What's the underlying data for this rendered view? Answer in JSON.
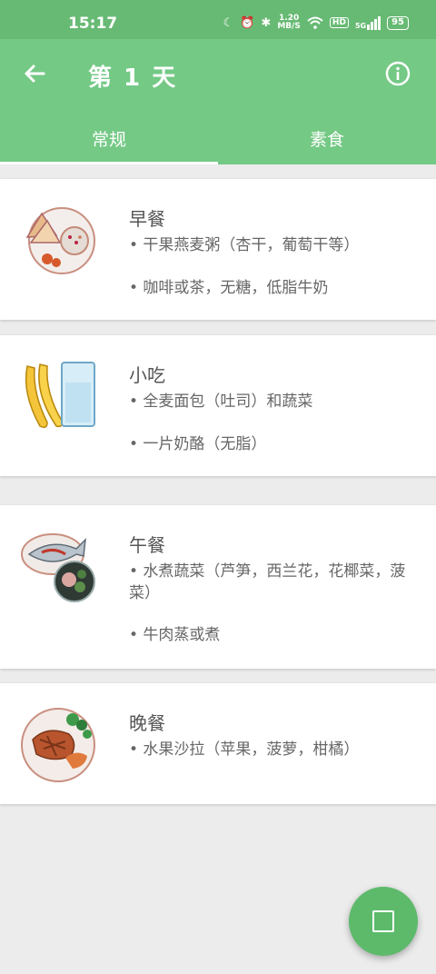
{
  "status": {
    "time": "15:17",
    "speed_value": "1.20",
    "speed_unit": "MB/S",
    "hd": "HD",
    "signal": "5G",
    "battery": "95"
  },
  "appbar": {
    "title": "第 1 天"
  },
  "tabs": [
    {
      "label": "常规",
      "active": true
    },
    {
      "label": "素食",
      "active": false
    }
  ],
  "meals": [
    {
      "title": "早餐",
      "items": [
        "• 干果燕麦粥（杏干，葡萄干等）",
        "• 咖啡或茶，无糖，低脂牛奶"
      ]
    },
    {
      "title": "小吃",
      "items": [
        "• 全麦面包（吐司）和蔬菜",
        "• 一片奶酪（无脂）"
      ]
    },
    {
      "title": "午餐",
      "items": [
        "• 水煮蔬菜（芦笋，西兰花，花椰菜，菠菜）",
        "• 牛肉蒸或煮"
      ]
    },
    {
      "title": "晚餐",
      "items": [
        "• 水果沙拉（苹果，菠萝，柑橘）"
      ]
    }
  ],
  "colors": {
    "statusbar": "#67ba73",
    "appbar": "#74c985",
    "fab": "#5dba6b"
  }
}
